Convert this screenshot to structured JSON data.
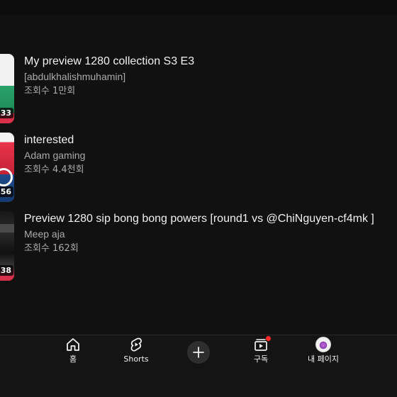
{
  "videos": [
    {
      "title": "My preview 1280 collection S3 E3",
      "channel": "[abdulkhalishmuhamin]",
      "views": "조회수 1만회",
      "duration": "33"
    },
    {
      "title": "interested",
      "channel": "Adam gaming",
      "views": "조회수 4.4천회",
      "duration": "56"
    },
    {
      "title": "Preview 1280 sip bong bong powers [round1 vs @ChiNguyen-cf4mk ]",
      "channel": "Meep aja",
      "views": "조회수 162회",
      "duration": "38"
    }
  ],
  "nav": {
    "home_label": "홈",
    "shorts_label": "Shorts",
    "subscriptions_label": "구독",
    "my_page_label": "내 페이지"
  },
  "icons": {
    "home": "home-icon",
    "shorts": "shorts-icon",
    "create": "plus-icon",
    "subscriptions": "subscriptions-icon",
    "avatar": "avatar"
  },
  "colors": {
    "background": "#111111",
    "text_primary": "#f1f1f1",
    "text_secondary": "#aaaaaa",
    "notification": "#ff2a2a"
  }
}
